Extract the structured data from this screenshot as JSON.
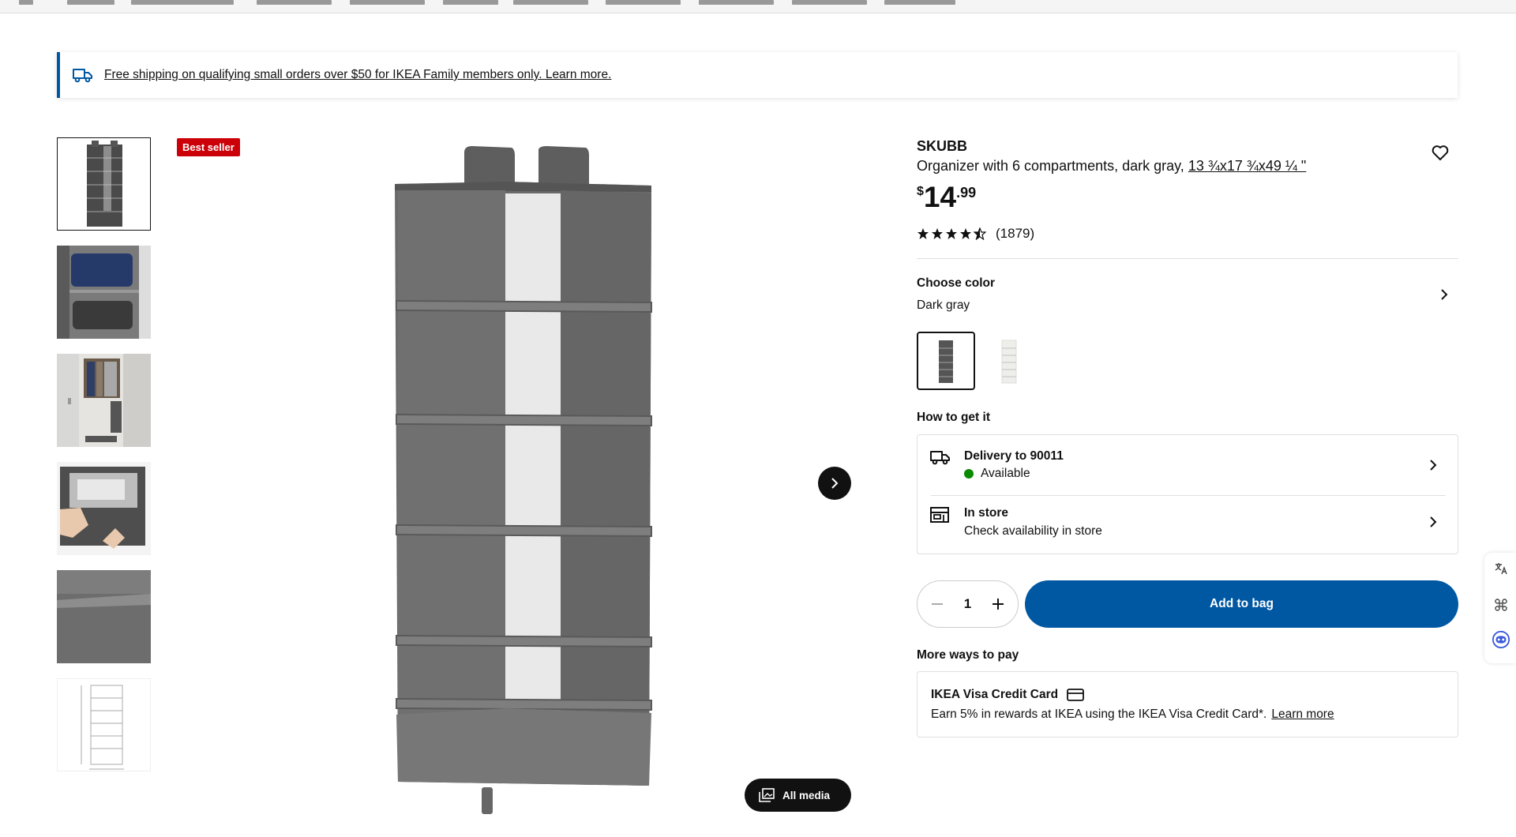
{
  "banner": {
    "text": "Free shipping on qualifying small orders over $50 for IKEA Family members only. Learn more."
  },
  "badge": "Best seller",
  "gallery": {
    "all_media_label": "All media",
    "thumb_count": 6,
    "selected_index": 0
  },
  "product": {
    "name": "SKUBB",
    "description": "Organizer with 6 compartments, dark gray,",
    "dimensions": "13 ¾x17 ¾x49 ¼ \"",
    "price_currency": "$",
    "price_integer": "14",
    "price_decimal": ".99",
    "rating_value": 4.5,
    "rating_count": "(1879)"
  },
  "color": {
    "label": "Choose color",
    "selected": "Dark gray",
    "options": [
      "dark gray",
      "white"
    ]
  },
  "how_to_get": {
    "label": "How to get it",
    "delivery_title": "Delivery to 90011",
    "delivery_status": "Available",
    "store_title": "In store",
    "store_sub": "Check availability in store"
  },
  "quantity": "1",
  "add_to_bag": "Add to bag",
  "pay": {
    "label": "More ways to pay",
    "card_title": "IKEA Visa Credit Card",
    "card_text": "Earn 5% in rewards at IKEA using the IKEA Visa Credit Card*.",
    "learn_more": "Learn more"
  },
  "colors": {
    "accent": "#0058a3",
    "badge": "#cc0008",
    "available": "#0a8a00"
  }
}
